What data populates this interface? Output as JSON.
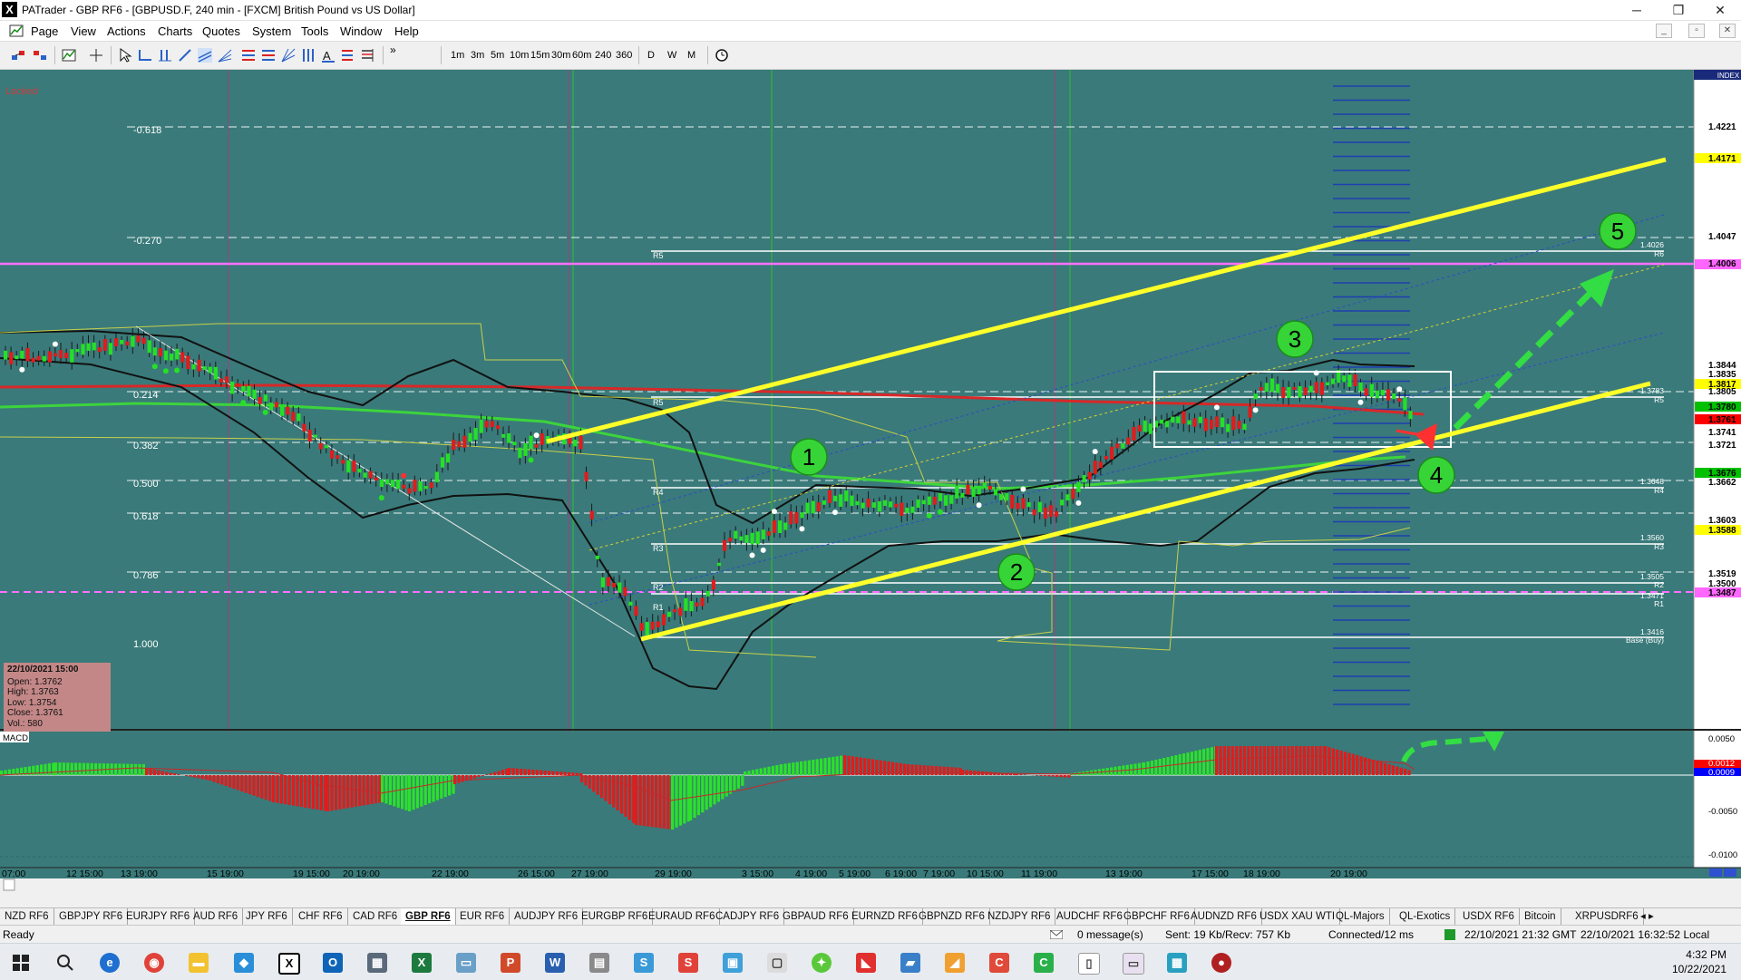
{
  "window": {
    "logo": "X",
    "title": "PATrader - GBP RF6 - [GBPUSD.F, 240 min - [FXCM] British Pound vs US Dollar]",
    "minimize": "─",
    "maximize": "❐",
    "close": "✕"
  },
  "menu": {
    "items": [
      "Page",
      "View",
      "Actions",
      "Charts",
      "Quotes",
      "System",
      "Tools",
      "Window",
      "Help"
    ],
    "mdi": [
      "_",
      "▫",
      "✕"
    ]
  },
  "toolbar": {
    "timeframes": [
      "1m",
      "3m",
      "5m",
      "10m",
      "15m",
      "30m",
      "60m",
      "240",
      "360",
      "D",
      "W",
      "M"
    ],
    "more": "»"
  },
  "chart": {
    "locked_label": "Locked",
    "fib_labels": [
      "-0.618",
      "-0.270",
      "0.214",
      "0.382",
      "0.500",
      "0.618",
      "0.786",
      "1.000"
    ],
    "pivot_left_labels": [
      "R5",
      "R5",
      "R4",
      "R3",
      "R2",
      "R1"
    ],
    "pivot_right_labels": [
      {
        "value": "1.4026",
        "name": "R6"
      },
      {
        "value": "1.3783",
        "name": "R5"
      },
      {
        "value": "1.3648",
        "name": "R4"
      },
      {
        "value": "1.3560",
        "name": "R3"
      },
      {
        "value": "1.3505",
        "name": "R2"
      },
      {
        "value": "1.3471",
        "name": "R1"
      },
      {
        "value": "1.3416",
        "name": "Base (Buy)"
      }
    ],
    "index_label": "INDEX",
    "price_axis": [
      "1.4221",
      "1.4171",
      "1.4047",
      "1.4006",
      "1.3844",
      "1.3835",
      "1.3817",
      "1.3805",
      "1.3780",
      "1.3761",
      "1.3741",
      "1.3721",
      "1.3676",
      "1.3662",
      "1.3603",
      "1.3588",
      "1.3519",
      "1.3500",
      "1.3487"
    ],
    "highlighted_prices": [
      {
        "value": "1.4171",
        "color": "#ffff00"
      },
      {
        "value": "1.4006",
        "color": "#ff66ff"
      },
      {
        "value": "1.3817",
        "color": "#ffff00"
      },
      {
        "value": "1.3780",
        "color": "#00c000"
      },
      {
        "value": "1.3761",
        "color": "#ff0000"
      },
      {
        "value": "1.3676",
        "color": "#00c000"
      },
      {
        "value": "1.3588",
        "color": "#ffff00"
      },
      {
        "value": "1.3487",
        "color": "#ff66ff"
      }
    ],
    "wave_labels": [
      "1",
      "2",
      "3",
      "4",
      "5"
    ],
    "time_axis": [
      "07:00",
      "12 15:00",
      "13 19:00",
      "15 19:00",
      "19 15:00",
      "20 19:00",
      "22 19:00",
      "26 15:00",
      "27 19:00",
      "29 19:00",
      "3 15:00",
      "4 19:00",
      "5 19:00",
      "6 19:00",
      "7 19:00",
      "10 15:00",
      "11 19:00",
      "13 19:00",
      "17 15:00",
      "18 19:00",
      "20 19:00"
    ]
  },
  "info_box": {
    "datetime": "22/10/2021 15:00",
    "open": "Open: 1.3762",
    "high": "High: 1.3763",
    "low": "Low: 1.3754",
    "close": "Close: 1.3761",
    "vol": "Vol.: 580"
  },
  "macd": {
    "label": "MACD",
    "axis": [
      "0.0050",
      "0.0012",
      "0.0009",
      "-0.0050",
      "-0.0100"
    ]
  },
  "tabs": [
    "NZD RF6",
    "GBPJPY RF6",
    "EURJPY RF6",
    "AUD RF6",
    "JPY RF6",
    "CHF RF6",
    "CAD RF6",
    "GBP RF6",
    "EUR RF6",
    "AUDJPY RF6",
    "EURGBP RF6",
    "EURAUD RF6",
    "CADJPY RF6",
    "GBPAUD RF6",
    "EURNZD RF6",
    "GBPNZD RF6",
    "NZDJPY RF6",
    "AUDCHF RF6",
    "GBPCHF RF6",
    "AUDNZD RF6",
    "USDX XAU WTI",
    "QL-Majors",
    "QL-Exotics",
    "USDX RF6",
    "Bitcoin",
    "XRPUSDRF6"
  ],
  "active_tab": "GBP RF6",
  "status": {
    "ready": "Ready",
    "messages": "0 message(s)",
    "traffic": "Sent: 19 Kb/Recv: 757 Kb",
    "connection": "Connected/12 ms",
    "gmt": "22/10/2021 21:32 GMT",
    "local": "22/10/2021 16:32:52 Local"
  },
  "taskbar": {
    "time": "4:32 PM",
    "date": "10/22/2021"
  }
}
